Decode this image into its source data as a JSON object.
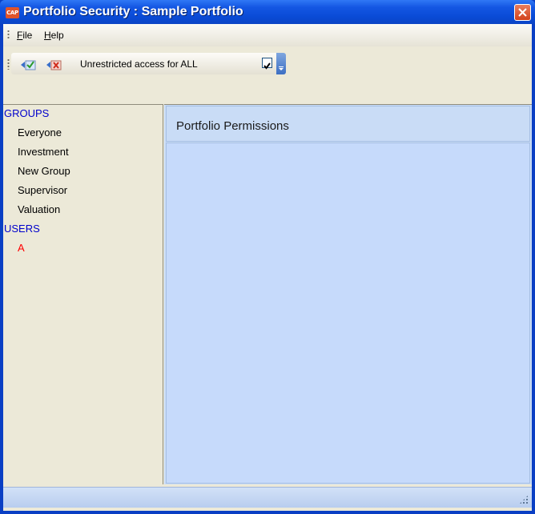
{
  "window": {
    "title": "Portfolio Security : Sample Portfolio",
    "app_icon_text": "CAP",
    "accent": "#0a4bd6"
  },
  "menubar": {
    "file": "File",
    "help": "Help"
  },
  "toolbar": {
    "restrict_label": "Unrestricted access for ALL",
    "restrict_checked": true
  },
  "tree": {
    "groups_header": "GROUPS",
    "groups": [
      "Everyone",
      "Investment",
      "New Group",
      "Supervisor",
      "Valuation"
    ],
    "users_header": "USERS",
    "users": [
      "A"
    ]
  },
  "main": {
    "title": "Portfolio Permissions"
  }
}
